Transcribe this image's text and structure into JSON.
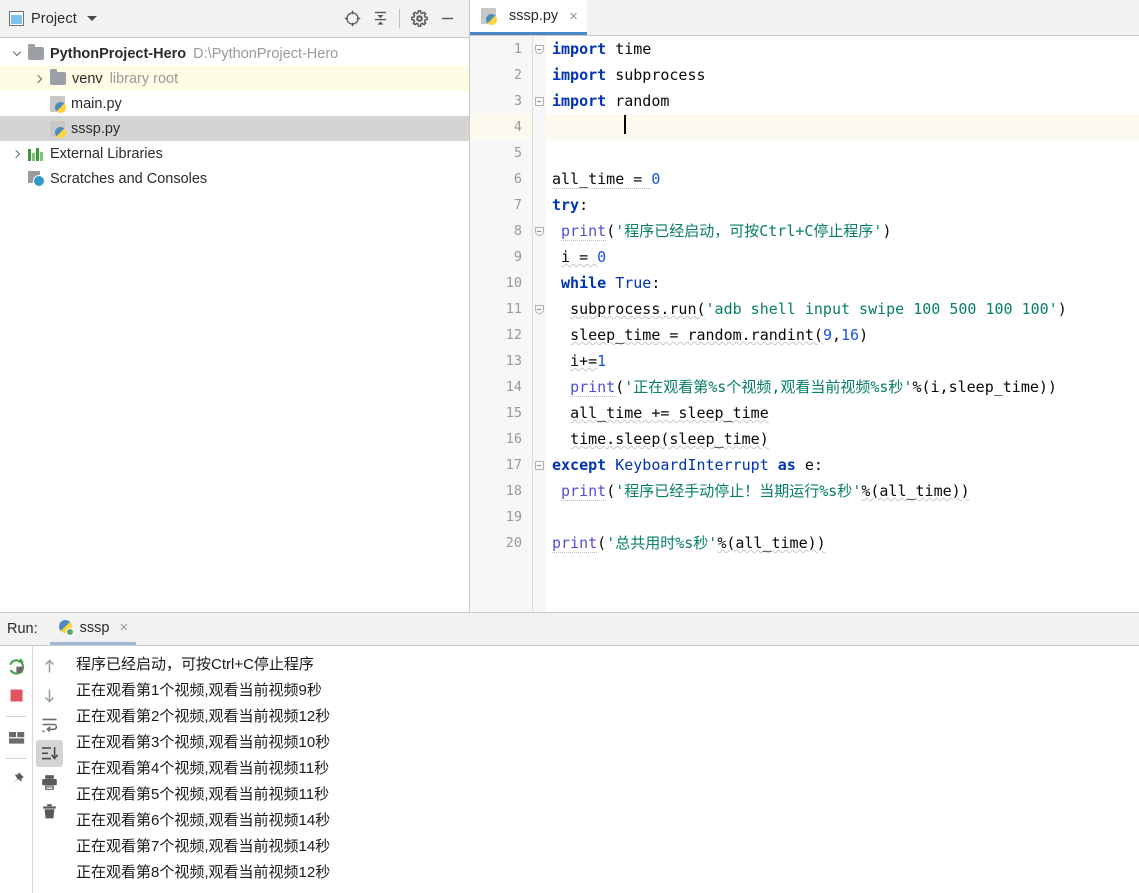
{
  "project_panel": {
    "title": "Project",
    "icons": [
      "project-square-icon",
      "caret-down-icon",
      "locate-target-icon",
      "collapse-all-icon",
      "settings-gear-icon",
      "minimize-icon"
    ],
    "tree": [
      {
        "id": "root",
        "label": "PythonProject-Hero",
        "suffix": "D:\\PythonProject-Hero",
        "icon": "folder-icon",
        "bold": true,
        "indent": 0,
        "expanded": true,
        "twisty": "open",
        "state": "none"
      },
      {
        "id": "venv",
        "label": "venv",
        "suffix": "library root",
        "icon": "folder-icon",
        "bold": false,
        "indent": 1,
        "expanded": false,
        "twisty": "closed",
        "state": "hover"
      },
      {
        "id": "main",
        "label": "main.py",
        "suffix": "",
        "icon": "python-file-icon",
        "bold": false,
        "indent": 2,
        "twisty": "none",
        "state": "none"
      },
      {
        "id": "sssp",
        "label": "sssp.py",
        "suffix": "",
        "icon": "python-file-icon",
        "bold": false,
        "indent": 2,
        "twisty": "none",
        "state": "selected"
      },
      {
        "id": "extlibs",
        "label": "External Libraries",
        "suffix": "",
        "icon": "external-libraries-icon",
        "bold": false,
        "indent": 0,
        "twisty": "closed",
        "state": "none"
      },
      {
        "id": "scratches",
        "label": "Scratches and Consoles",
        "suffix": "",
        "icon": "scratches-icon",
        "bold": false,
        "indent": 0,
        "twisty": "none",
        "state": "none"
      }
    ]
  },
  "editor": {
    "tab": {
      "label": "sssp.py",
      "icon": "python-file-icon",
      "close": "×"
    },
    "current_line": 4,
    "line_numbers": [
      1,
      2,
      3,
      4,
      5,
      6,
      7,
      8,
      9,
      10,
      11,
      12,
      13,
      14,
      15,
      16,
      17,
      18,
      19,
      20
    ],
    "lines": [
      {
        "n": 1,
        "text": "import time"
      },
      {
        "n": 2,
        "text": "import subprocess"
      },
      {
        "n": 3,
        "text": "import random"
      },
      {
        "n": 4,
        "text": ""
      },
      {
        "n": 5,
        "text": ""
      },
      {
        "n": 6,
        "text": "all_time = 0"
      },
      {
        "n": 7,
        "text": "try:"
      },
      {
        "n": 8,
        "text": "    print('程序已经启动，可按Ctrl+C停止程序')"
      },
      {
        "n": 9,
        "text": "    i = 0"
      },
      {
        "n": 10,
        "text": "    while True:"
      },
      {
        "n": 11,
        "text": "        subprocess.run('adb shell input swipe 100 500 100 100')"
      },
      {
        "n": 12,
        "text": "        sleep_time = random.randint(9,16)"
      },
      {
        "n": 13,
        "text": "        i+=1"
      },
      {
        "n": 14,
        "text": "        print('正在观看第%s个视频,观看当前视频%s秒'%(i,sleep_time))"
      },
      {
        "n": 15,
        "text": "        all_time += sleep_time"
      },
      {
        "n": 16,
        "text": "        time.sleep(sleep_time)"
      },
      {
        "n": 17,
        "text": "except KeyboardInterrupt as e:"
      },
      {
        "n": 18,
        "text": "    print('程序已经手动停止！当期运行%s秒'%(all_time))"
      },
      {
        "n": 19,
        "text": ""
      },
      {
        "n": 20,
        "text": "print('总共用时%s秒'%(all_time))"
      }
    ],
    "tokens": {
      "l1": [
        [
          "kw",
          "import"
        ],
        [
          "id",
          " time"
        ]
      ],
      "l2": [
        [
          "kw",
          "import"
        ],
        [
          "id",
          " subprocess"
        ]
      ],
      "l3": [
        [
          "kw",
          "import"
        ],
        [
          "id",
          " random"
        ]
      ],
      "l6": [
        [
          "id",
          "all_time = "
        ],
        [
          "num",
          "0"
        ]
      ],
      "l7": [
        [
          "kw",
          "try"
        ],
        [
          "id",
          ":"
        ]
      ],
      "l8": [
        [
          "fn",
          "print"
        ],
        [
          "id",
          "("
        ],
        [
          "str",
          "'程序已经启动，可按Ctrl+C停止程序'"
        ],
        [
          "id",
          ")"
        ]
      ],
      "l9": [
        [
          "id",
          "i = "
        ],
        [
          "num",
          "0"
        ]
      ],
      "l10": [
        [
          "kw",
          "while"
        ],
        [
          "id",
          " "
        ],
        [
          "kwp",
          "True"
        ],
        [
          "id",
          ":"
        ]
      ],
      "l11": [
        [
          "id",
          "subprocess.run("
        ],
        [
          "str",
          "'adb shell input swipe 100 500 100 100'"
        ],
        [
          "id",
          ")"
        ]
      ],
      "l12": [
        [
          "id",
          "sleep_time = random.randint("
        ],
        [
          "num",
          "9"
        ],
        [
          "id",
          ","
        ],
        [
          "num",
          "16"
        ],
        [
          "id",
          ")"
        ]
      ],
      "l13": [
        [
          "id",
          "i+="
        ],
        [
          "num",
          "1"
        ]
      ],
      "l14": [
        [
          "fn",
          "print"
        ],
        [
          "id",
          "("
        ],
        [
          "str",
          "'正在观看第%s个视频,观看当前视频%s秒'"
        ],
        [
          "id",
          "%(i,sleep_time))"
        ]
      ],
      "l15": [
        [
          "id",
          "all_time += sleep_time"
        ]
      ],
      "l16": [
        [
          "id",
          "time.sleep(sleep_time)"
        ]
      ],
      "l17": [
        [
          "kw",
          "except"
        ],
        [
          "id",
          " "
        ],
        [
          "cls",
          "KeyboardInterrupt"
        ],
        [
          "id",
          " "
        ],
        [
          "kw",
          "as"
        ],
        [
          "id",
          " e:"
        ]
      ],
      "l18": [
        [
          "fn",
          "print"
        ],
        [
          "id",
          "("
        ],
        [
          "str",
          "'程序已经手动停止！当期运行%s秒'"
        ],
        [
          "id",
          "%(all_time))"
        ]
      ],
      "l20": [
        [
          "fn",
          "print"
        ],
        [
          "id",
          "("
        ],
        [
          "str",
          "'总共用时%s秒'"
        ],
        [
          "id",
          "%(all_time))"
        ]
      ]
    },
    "colors": {
      "keyword": "#0033b3",
      "string": "#067d68",
      "number": "#1750eb",
      "function": "#4f4fd0",
      "identifier": "#080808",
      "current_line_bg": "#fcfaef",
      "gutter_bg": "#f7f7f7",
      "tab_underline": "#4a86c8"
    }
  },
  "run_panel": {
    "label": "Run:",
    "tab": {
      "label": "sssp",
      "icon": "python-run-icon",
      "close": "×"
    },
    "toolbar_left": [
      "rerun-icon",
      "stop-icon",
      "layout-icon",
      "pin-icon"
    ],
    "toolbar_right": [
      "up-arrow-icon",
      "down-arrow-icon",
      "soft-wrap-icon",
      "scroll-to-end-icon",
      "print-icon",
      "trash-icon"
    ],
    "active_tool": "scroll-to-end-icon",
    "console_lines": [
      "程序已经启动，可按Ctrl+C停止程序",
      "正在观看第1个视频,观看当前视频9秒",
      "正在观看第2个视频,观看当前视频12秒",
      "正在观看第3个视频,观看当前视频10秒",
      "正在观看第4个视频,观看当前视频11秒",
      "正在观看第5个视频,观看当前视频11秒",
      "正在观看第6个视频,观看当前视频14秒",
      "正在观看第7个视频,观看当前视频14秒",
      "正在观看第8个视频,观看当前视频12秒"
    ]
  }
}
